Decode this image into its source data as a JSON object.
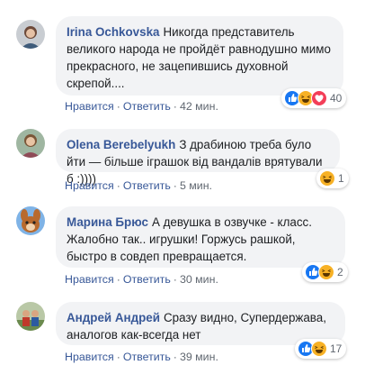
{
  "comments": [
    {
      "author": "Irina Ochkovska",
      "text": "Никогда представитель великого народа не пройдёт равнодушно мимо прекрасного, не зацепившись духовной скрепой....",
      "like": "Нравится",
      "reply": "Ответить",
      "time": "42 мин.",
      "reactions": [
        "like-icon",
        "haha-icon",
        "love-icon"
      ],
      "reaction_count": "40"
    },
    {
      "author": "Olena Berebelyukh",
      "text": "З драбиною треба було йти — більше іграшок від вандалів врятували б :))))",
      "like": "Нравится",
      "reply": "Ответить",
      "time": "5 мин.",
      "reactions": [
        "haha-icon"
      ],
      "reaction_count": "1"
    },
    {
      "author": "Марина Брюс",
      "text": "А девушка в озвучке - класс. Жалобно так.. игрушки! Горжусь рашкой, быстро в совдеп превращается.",
      "like": "Нравится",
      "reply": "Ответить",
      "time": "30 мин.",
      "reactions": [
        "like-icon",
        "haha-icon"
      ],
      "reaction_count": "2"
    },
    {
      "author": "Андрей Андрей",
      "text": "Сразу видно, Супердержава, аналогов как-всегда нет",
      "like": "Нравится",
      "reply": "Ответить",
      "time": "39 мин.",
      "reactions": [
        "like-icon",
        "haha-icon"
      ],
      "reaction_count": "17"
    }
  ],
  "colors": {
    "author": "#385898",
    "bubble": "#f2f3f5",
    "meta": "#606770",
    "like": "#1877f2",
    "haha": "#f7b125",
    "love": "#f33e58"
  }
}
